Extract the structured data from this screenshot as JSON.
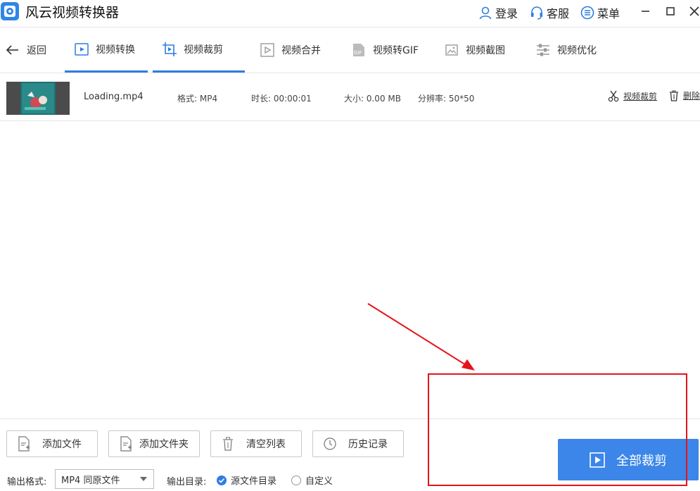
{
  "app": {
    "title": "风云视频转换器"
  },
  "header": {
    "login": "登录",
    "support": "客服",
    "menu": "菜单"
  },
  "tabs": {
    "back": "返回",
    "items": [
      {
        "label": "视频转换",
        "icon": "video-convert-icon"
      },
      {
        "label": "视频裁剪",
        "icon": "video-crop-icon"
      },
      {
        "label": "视频合并",
        "icon": "video-merge-icon"
      },
      {
        "label": "视频转GIF",
        "icon": "gif-icon"
      },
      {
        "label": "视频截图",
        "icon": "screenshot-icon"
      },
      {
        "label": "视频优化",
        "icon": "sliders-icon"
      }
    ]
  },
  "file": {
    "name": "Loading.mp4",
    "format": "格式: MP4",
    "duration": "时长: 00:00:01",
    "size": "大小: 0.00 MB",
    "resolution": "分辨率: 50*50",
    "crop_label": "视频裁剪",
    "delete_label": "删除"
  },
  "buttons": {
    "add_file": "添加文件",
    "add_folder": "添加文件夹",
    "clear_list": "清空列表",
    "history": "历史记录",
    "start_all": "全部裁剪"
  },
  "output": {
    "format_label": "输出格式:",
    "format_value": "MP4 同原文件",
    "dir_label": "输出目录:",
    "dir_source": "源文件目录",
    "dir_custom": "自定义",
    "selected": "源文件目录"
  },
  "colors": {
    "accent": "#3b86e8",
    "annotation": "#e5141a"
  }
}
